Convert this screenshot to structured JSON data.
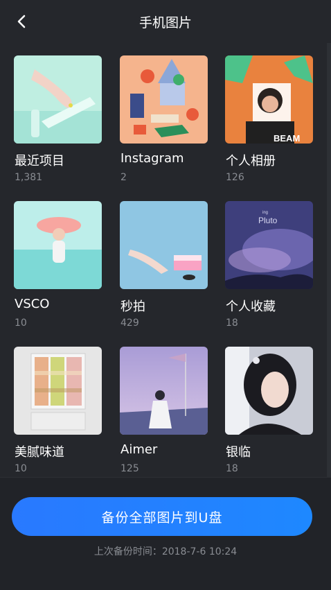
{
  "header": {
    "title": "手机图片"
  },
  "albums": [
    {
      "name": "最近项目",
      "count": "1,381"
    },
    {
      "name": "Instagram",
      "count": "2"
    },
    {
      "name": "个人相册",
      "count": "126"
    },
    {
      "name": "VSCO",
      "count": "10"
    },
    {
      "name": "秒拍",
      "count": "429"
    },
    {
      "name": "个人收藏",
      "count": "18"
    },
    {
      "name": "美腻味道",
      "count": "10"
    },
    {
      "name": "Aimer",
      "count": "125"
    },
    {
      "name": "银临",
      "count": "18"
    }
  ],
  "thumb_text": {
    "beam": "BEAM",
    "pluto_small": "ing",
    "pluto": "Pluto"
  },
  "footer": {
    "backup_button": "备份全部图片到U盘",
    "last_backup": "上次备份时间：2018-7-6  10:24"
  }
}
